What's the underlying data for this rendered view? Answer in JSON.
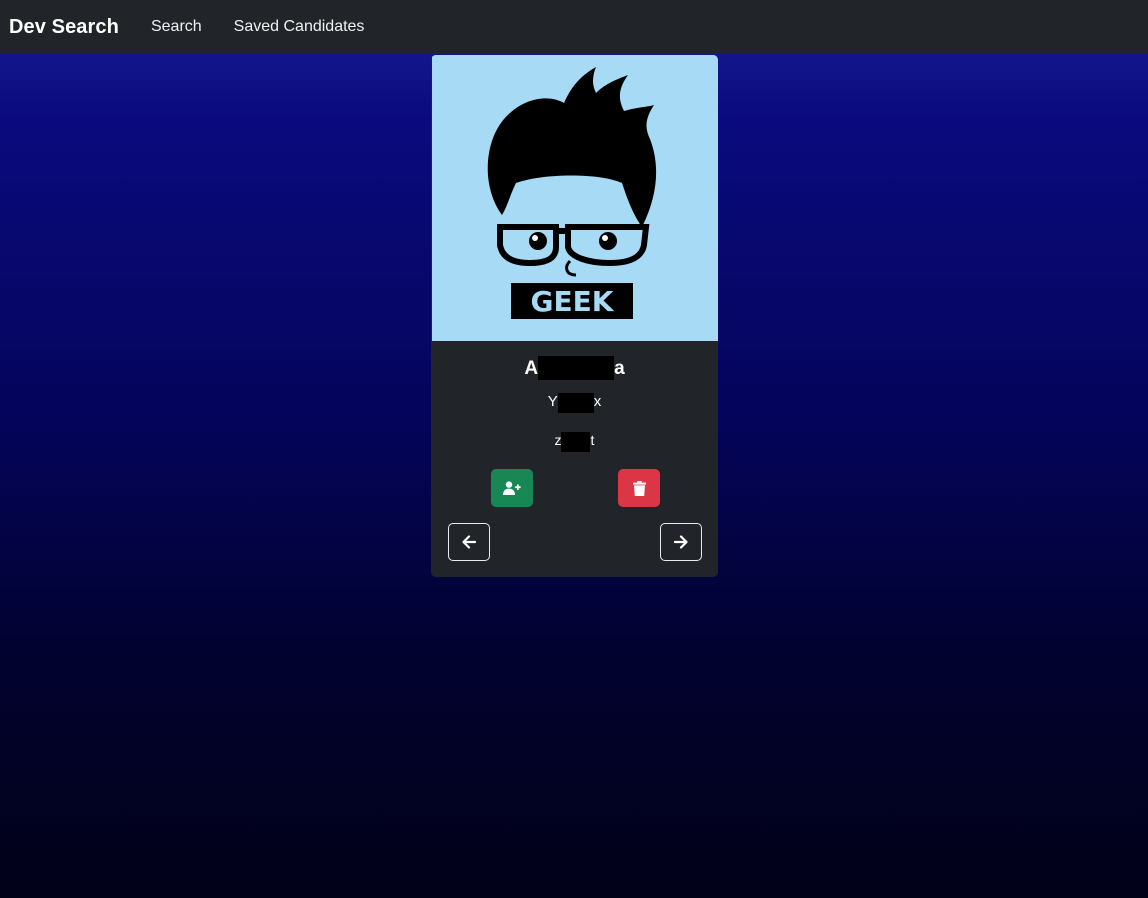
{
  "navbar": {
    "brand": "Dev Search",
    "links": [
      "Search",
      "Saved Candidates"
    ]
  },
  "candidate": {
    "avatar_text": "GEEK",
    "name_visible_start": "A",
    "name_visible_end": "a",
    "login_visible_start": "Y",
    "login_visible_end": "x",
    "company_visible_start": "z",
    "company_visible_end": "t"
  },
  "buttons": {
    "save_icon": "user-plus-icon",
    "delete_icon": "trash-icon",
    "prev_icon": "arrow-left-icon",
    "next_icon": "arrow-right-icon"
  },
  "colors": {
    "navbar": "#212529",
    "save": "#198754",
    "delete": "#dc3545",
    "avatar_bg": "#a7daf5"
  }
}
